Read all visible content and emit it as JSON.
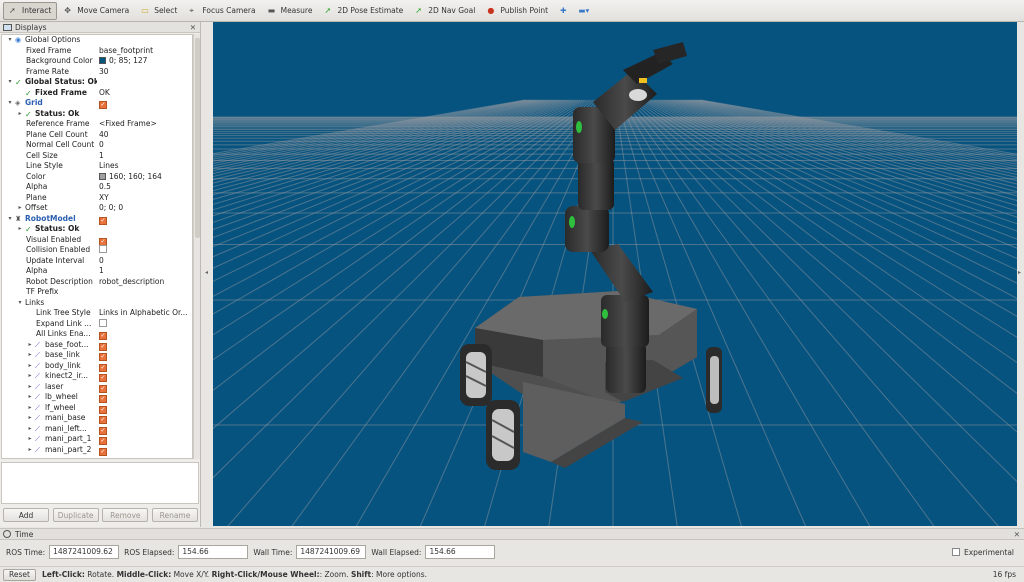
{
  "toolbar": {
    "tools": [
      {
        "id": "interact",
        "label": "Interact",
        "icon": "cursor-icon",
        "active": true
      },
      {
        "id": "move-camera",
        "label": "Move Camera",
        "icon": "move-arrows-icon"
      },
      {
        "id": "select",
        "label": "Select",
        "icon": "select-rect-icon"
      },
      {
        "id": "focus-camera",
        "label": "Focus Camera",
        "icon": "crosshair-icon"
      },
      {
        "id": "measure",
        "label": "Measure",
        "icon": "ruler-icon"
      },
      {
        "id": "pose-estimate",
        "label": "2D Pose Estimate",
        "icon": "green-arrow-icon"
      },
      {
        "id": "nav-goal",
        "label": "2D Nav Goal",
        "icon": "green-arrow-icon"
      },
      {
        "id": "publish-point",
        "label": "Publish Point",
        "icon": "red-pin-icon"
      }
    ]
  },
  "displays": {
    "title": "Displays",
    "rows": [
      {
        "depth": 0,
        "arrow": "▾",
        "icon": "globe-icon",
        "label": "Global Options",
        "value": ""
      },
      {
        "depth": 1,
        "label": "Fixed Frame",
        "value": "base_footprint"
      },
      {
        "depth": 1,
        "label": "Background Color",
        "value": "0; 85; 127",
        "swatch": "#00557f"
      },
      {
        "depth": 1,
        "label": "Frame Rate",
        "value": "30"
      },
      {
        "depth": 0,
        "arrow": "▾",
        "tick": true,
        "label": "Global Status: Ok",
        "value": "",
        "style": "bold"
      },
      {
        "depth": 1,
        "tick": true,
        "label": "Fixed Frame",
        "value": "OK",
        "style": "bold"
      },
      {
        "depth": 0,
        "arrow": "▾",
        "icon": "grid-icon",
        "label": "Grid",
        "value": "",
        "check": true,
        "style": "blue"
      },
      {
        "depth": 1,
        "arrow": "▸",
        "tick": true,
        "label": "Status: Ok",
        "value": "",
        "style": "bold"
      },
      {
        "depth": 1,
        "label": "Reference Frame",
        "value": "<Fixed Frame>"
      },
      {
        "depth": 1,
        "label": "Plane Cell Count",
        "value": "40"
      },
      {
        "depth": 1,
        "label": "Normal Cell Count",
        "value": "0"
      },
      {
        "depth": 1,
        "label": "Cell Size",
        "value": "1"
      },
      {
        "depth": 1,
        "label": "Line Style",
        "value": "Lines"
      },
      {
        "depth": 1,
        "label": "Color",
        "value": "160; 160; 164",
        "swatch": "#a0a0a4"
      },
      {
        "depth": 1,
        "label": "Alpha",
        "value": "0.5"
      },
      {
        "depth": 1,
        "label": "Plane",
        "value": "XY"
      },
      {
        "depth": 1,
        "arrow": "▸",
        "label": "Offset",
        "value": "0; 0; 0"
      },
      {
        "depth": 0,
        "arrow": "▾",
        "icon": "robot-icon",
        "label": "RobotModel",
        "value": "",
        "check": true,
        "style": "blue"
      },
      {
        "depth": 1,
        "arrow": "▸",
        "tick": true,
        "label": "Status: Ok",
        "value": "",
        "style": "bold"
      },
      {
        "depth": 1,
        "label": "Visual Enabled",
        "value": "",
        "check": true
      },
      {
        "depth": 1,
        "label": "Collision Enabled",
        "value": "",
        "check": false
      },
      {
        "depth": 1,
        "label": "Update Interval",
        "value": "0"
      },
      {
        "depth": 1,
        "label": "Alpha",
        "value": "1"
      },
      {
        "depth": 1,
        "label": "Robot Description",
        "value": "robot_description"
      },
      {
        "depth": 1,
        "label": "TF Prefix",
        "value": ""
      },
      {
        "depth": 1,
        "arrow": "▾",
        "label": "Links",
        "value": ""
      },
      {
        "depth": 2,
        "label": "Link Tree Style",
        "value": "Links in Alphabetic Or..."
      },
      {
        "depth": 2,
        "label": "Expand Link ...",
        "value": "",
        "check": false
      },
      {
        "depth": 2,
        "label": "All Links Ena...",
        "value": "",
        "check": true
      },
      {
        "depth": 2,
        "arrow": "▸",
        "icon": "link-icon",
        "label": "base_foot...",
        "value": "",
        "check": true
      },
      {
        "depth": 2,
        "arrow": "▸",
        "icon": "link-icon",
        "label": "base_link",
        "value": "",
        "check": true
      },
      {
        "depth": 2,
        "arrow": "▸",
        "icon": "link-icon",
        "label": "body_link",
        "value": "",
        "check": true
      },
      {
        "depth": 2,
        "arrow": "▸",
        "icon": "link-icon",
        "label": "kinect2_ir...",
        "value": "",
        "check": true
      },
      {
        "depth": 2,
        "arrow": "▸",
        "icon": "link-icon",
        "label": "laser",
        "value": "",
        "check": true
      },
      {
        "depth": 2,
        "arrow": "▸",
        "icon": "link-icon",
        "label": "lb_wheel",
        "value": "",
        "check": true
      },
      {
        "depth": 2,
        "arrow": "▸",
        "icon": "link-icon",
        "label": "lf_wheel",
        "value": "",
        "check": true
      },
      {
        "depth": 2,
        "arrow": "▸",
        "icon": "link-icon",
        "label": "mani_base",
        "value": "",
        "check": true
      },
      {
        "depth": 2,
        "arrow": "▸",
        "icon": "link-icon",
        "label": "mani_left...",
        "value": "",
        "check": true
      },
      {
        "depth": 2,
        "arrow": "▸",
        "icon": "link-icon",
        "label": "mani_part_1",
        "value": "",
        "check": true
      },
      {
        "depth": 2,
        "arrow": "▸",
        "icon": "link-icon",
        "label": "mani_part_2",
        "value": "",
        "check": true
      }
    ],
    "buttons": {
      "add": "Add",
      "duplicate": "Duplicate",
      "remove": "Remove",
      "rename": "Rename"
    }
  },
  "time": {
    "title": "Time",
    "ros_time_label": "ROS Time:",
    "ros_time": "1487241009.62",
    "ros_elapsed_label": "ROS Elapsed:",
    "ros_elapsed": "154.66",
    "wall_time_label": "Wall Time:",
    "wall_time": "1487241009.69",
    "wall_elapsed_label": "Wall Elapsed:",
    "wall_elapsed": "154.66",
    "experimental_label": "Experimental"
  },
  "status": {
    "reset": "Reset",
    "hint_parts": [
      {
        "text": "Left-Click:",
        "bold": true
      },
      {
        "text": " Rotate. ",
        "bold": false
      },
      {
        "text": "Middle-Click:",
        "bold": true
      },
      {
        "text": " Move X/Y. ",
        "bold": false
      },
      {
        "text": "Right-Click/Mouse Wheel:",
        "bold": true
      },
      {
        "text": ": Zoom. ",
        "bold": false
      },
      {
        "text": "Shift",
        "bold": true
      },
      {
        "text": ": More options.",
        "bold": false
      }
    ],
    "fps": "16 fps"
  },
  "colors": {
    "viewport_bg": "#07537f",
    "grid_line": "#a0a0a4",
    "checkbox_on": "#e8723c",
    "accent_blue": "#2a5fb0"
  }
}
